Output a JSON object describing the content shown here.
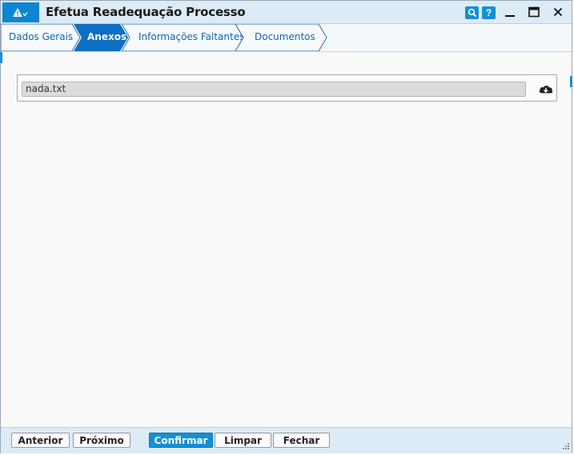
{
  "window": {
    "title": "Efetua Readequação Processo"
  },
  "titlebar_buttons": {
    "search_icon": "search-icon",
    "help_label": "?",
    "minimize": "minimize-icon",
    "maximize": "maximize-icon",
    "close": "close-icon"
  },
  "tabs": [
    {
      "label": "Dados Gerais",
      "active": false
    },
    {
      "label": "Anexos",
      "active": true
    },
    {
      "label": "Informações Faltantes",
      "active": false
    },
    {
      "label": "Documentos",
      "active": false
    }
  ],
  "attachment": {
    "file_name": "nada.txt",
    "download_icon": "cloud-download-icon"
  },
  "footer": {
    "previous_label": "Anterior",
    "next_label": "Próximo",
    "confirm_label": "Confirmar",
    "clear_label": "Limpar",
    "close_label": "Fechar"
  },
  "colors": {
    "accent": "#1590d6",
    "active_tab": "#0d6fc4",
    "titlebar_bg": "#dcebf6"
  }
}
